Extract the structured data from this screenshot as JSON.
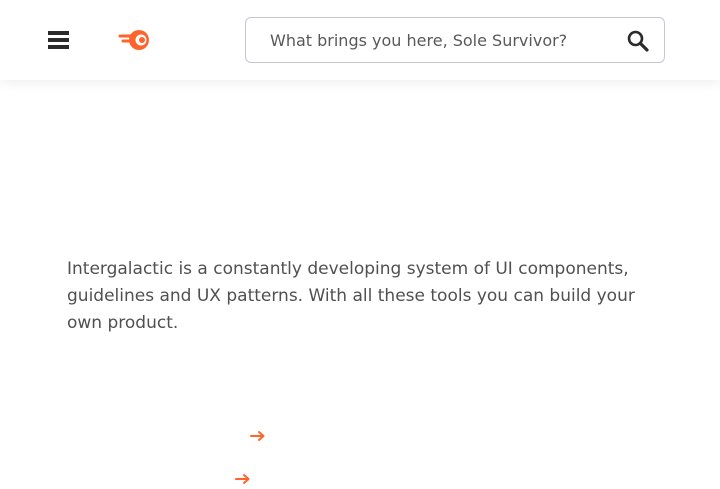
{
  "header": {
    "menu_icon": "hamburger-menu-icon",
    "logo_icon": "fire-logo-icon",
    "search": {
      "placeholder": "What brings you here, Sole Survivor?",
      "value": "",
      "icon": "search-icon"
    }
  },
  "main": {
    "intro_text": "Intergalactic is a constantly developing system of UI components, guidelines and UX patterns. With all these tools you can build your own product.",
    "links": [
      {
        "icon": "arrow-right-icon"
      },
      {
        "icon": "arrow-right-icon"
      }
    ]
  },
  "colors": {
    "accent": "#ff642d",
    "text": "#505050",
    "icon_dark": "#2b2b2b"
  }
}
